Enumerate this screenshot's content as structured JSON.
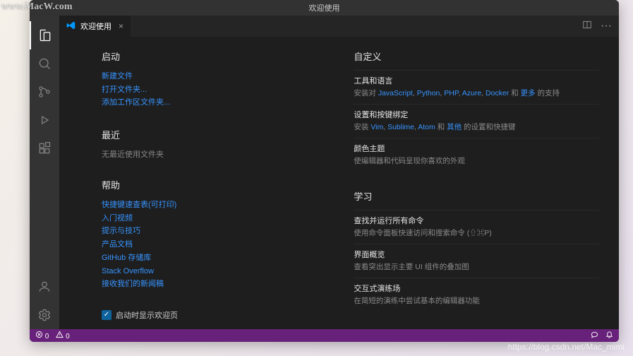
{
  "watermark_tl": "www.MacW.com",
  "watermark_br": "https://blog.csdn.net/Mac_mimi",
  "titlebar": "欢迎使用",
  "tab": {
    "label": "欢迎使用"
  },
  "left": {
    "start": {
      "title": "启动",
      "links": [
        "新建文件",
        "打开文件夹...",
        "添加工作区文件夹..."
      ]
    },
    "recent": {
      "title": "最近",
      "empty": "无最近使用文件夹"
    },
    "help": {
      "title": "帮助",
      "links": [
        "快捷键速查表(可打印)",
        "入门视频",
        "提示与技巧",
        "产品文档",
        "GitHub 存储库",
        "Stack Overflow",
        "接收我们的新闻稿"
      ]
    },
    "show_on_startup": "启动时显示欢迎页"
  },
  "right": {
    "customize": {
      "title": "自定义",
      "tools": {
        "head": "工具和语言",
        "prefix": "安装对 ",
        "links": [
          "JavaScript",
          "Python",
          "PHP",
          "Azure",
          "Docker"
        ],
        "and": " 和 ",
        "more": "更多",
        "suffix": " 的支持"
      },
      "keymaps": {
        "head": "设置和按键绑定",
        "prefix": "安装 ",
        "links": [
          "Vim",
          "Sublime",
          "Atom"
        ],
        "and": " 和 ",
        "other": "其他",
        "suffix": " 的设置和快捷键"
      },
      "theme": {
        "head": "颜色主题",
        "desc": "使编辑器和代码呈现你喜欢的外观"
      }
    },
    "learn": {
      "title": "学习",
      "commands": {
        "head": "查找并运行所有命令",
        "desc": "使用命令面板快速访问和搜索命令 (⇧⌘P)"
      },
      "overview": {
        "head": "界面概览",
        "desc": "查看突出显示主要 UI 组件的叠加图"
      },
      "playground": {
        "head": "交互式演练场",
        "desc": "在简短的演练中尝试基本的编辑器功能"
      }
    }
  },
  "status": {
    "errors": "0",
    "warnings": "0"
  }
}
